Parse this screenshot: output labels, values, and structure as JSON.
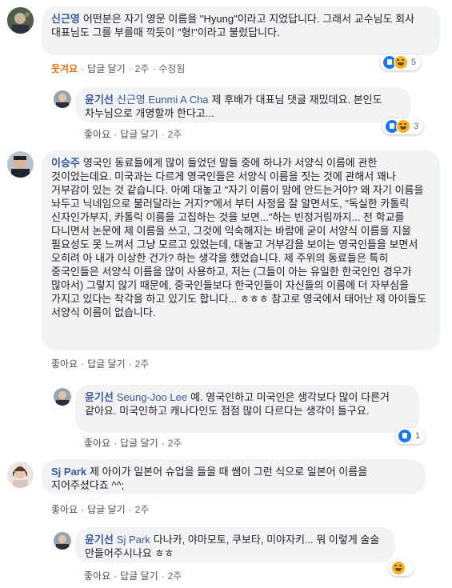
{
  "comments": [
    {
      "author": "신근영",
      "text": "어떤분은 자기 영문 이름을 \"Hyung\"이라고 지었답니다. 그래서 교수님도 회사 대표님도 그를 부를때 깍듯이 \"형!\"이라고 불렀답니다.",
      "actions": {
        "like": "웃겨요",
        "reply": "답글 달기",
        "time": "2주",
        "edited": "수정됨"
      },
      "reactions": {
        "icons": [
          "like-icon",
          "haha-icon"
        ],
        "count": "5"
      }
    },
    {
      "author": "윤기선",
      "tag": "신근영 Eunmi A Cha",
      "text": "제 후배가 대표님 댓글 재밌데요. 본인도 차누님으로 개명할까 한다고...",
      "actions": {
        "like": "좋아요",
        "reply": "답글 달기",
        "time": "2주"
      },
      "reactions": {
        "icons": [
          "like-icon",
          "haha-icon"
        ],
        "count": "3"
      }
    },
    {
      "author": "이승주",
      "text": "영국인 동료들에게 많이 들었던 말들 중에 하나가 서양식 이름에 관한 것이었는데요. 미국과는 다르게 영국인들은 서양식 이름을 짓는 것에 관해서 꽤나 거부감이 있는 것 같습니다. 아예 대놓고 \"자기 이름이 맘에 안드는거야? 왜 자기 이름을 놔두고 닉네임으로 불러달라는 거지?\"에서 부터 사정을 잘 알면서도, \"독실한 카톨릭 신자인가부지, 카톨릭 이름을 고집하는 것을 보면...\"하는 빈정거림까지... 전 학교를 다니면서 논문에 제 이름을 쓰고, 그것에 익숙해지는 바람에 굳이 서양식 이름을 지을 필요성도 못 느껴서 그냥 모르고 있었는데, 대놓고 거부감을 보이는 영국인들을 보면서 오히려 아 내가 이상한 건가? 하는 생각을 했었습니다. 제 주위의 동료들은 특히 중국인들은 서양식 이름을 많이 사용하고, 저는 (그들이 아는 유일한 한국인인 경우가 많아서) 그렇지 않기 때문에, 중국인들보다 한국인들이 자신들의 이름에 더 자부심을 가지고 있다는 착각을 하고 있기도 합니다... ㅎㅎㅎ 참고로 영국에서 태어난 제 아이들도 서양식 이름이 없습니다.",
      "actions": {
        "like": "좋아요",
        "reply": "답글 달기",
        "time": "2주"
      }
    },
    {
      "author": "윤기선",
      "tag": "Seung-Joo Lee",
      "text": "예. 영국인하고 미국인은 생각보다 많이 다른거 같아요. 미국인하고 캐나다인도 점점 많이 다르다는 생각이 들구요.",
      "actions": {
        "like": "좋아요",
        "reply": "답글 달기",
        "time": "2주"
      },
      "reactions": {
        "icons": [
          "like-icon"
        ],
        "count": "1"
      }
    },
    {
      "author": "Sj Park",
      "text": "제 아이가 일본어 슈업을 들을 때 쌤이 그런 식으로 일본어 이름을 지어주셨다죠 ^^;",
      "actions": {
        "like": "좋아요",
        "reply": "답글 달기",
        "time": "2주"
      }
    },
    {
      "author": "윤기선",
      "tag": "Sj Park",
      "text": "다나카, 야마모토, 쿠보타, 미야자키... 뭐 이렇게 술술 만들어주시나요 ㅎㅎ",
      "actions": {
        "like": "좋아요",
        "reply": "답글 달기",
        "time": "2주"
      },
      "reactions": {
        "icons": [
          "haha-icon"
        ],
        "count": ""
      }
    }
  ]
}
